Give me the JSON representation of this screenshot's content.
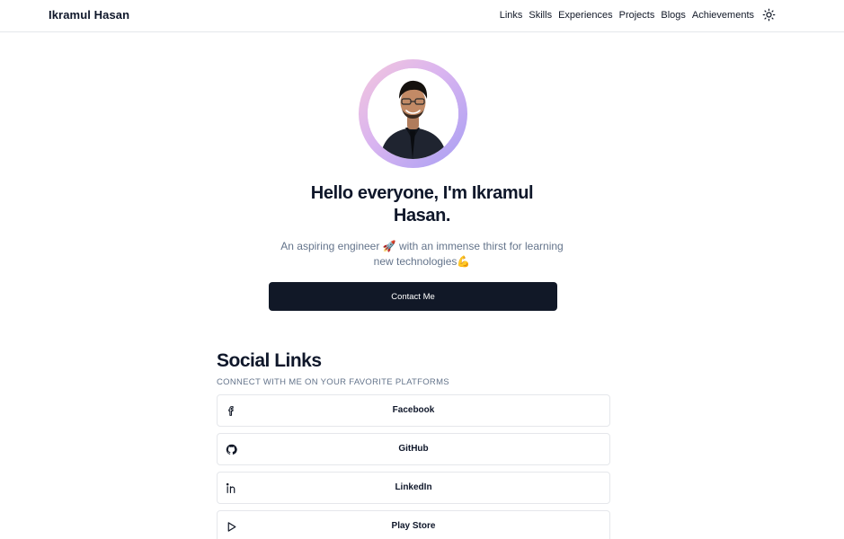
{
  "header": {
    "brand": "Ikramul Hasan",
    "nav": [
      {
        "label": "Links"
      },
      {
        "label": "Skills"
      },
      {
        "label": "Experiences"
      },
      {
        "label": "Projects"
      },
      {
        "label": "Blogs"
      },
      {
        "label": "Achievements"
      }
    ],
    "theme_toggle_icon": "sun-icon"
  },
  "hero": {
    "avatar_icon": "profile-photo",
    "title_line1": "Hello everyone, I'm Ikramul",
    "title_line2": "Hasan.",
    "subtitle_line1": "An aspiring engineer 🚀 with an immense thirst for learning",
    "subtitle_line2": "new technologies💪",
    "contact_label": "Contact Me"
  },
  "social": {
    "title": "Social Links",
    "subtitle": "CONNECT WITH ME ON YOUR FAVORITE PLATFORMS",
    "items": [
      {
        "label": "Facebook",
        "icon": "facebook-icon"
      },
      {
        "label": "GitHub",
        "icon": "github-icon"
      },
      {
        "label": "LinkedIn",
        "icon": "linkedin-icon"
      },
      {
        "label": "Play Store",
        "icon": "play-store-icon"
      }
    ]
  },
  "colors": {
    "text": "#0f172a",
    "muted": "#64748b",
    "button_bg": "#111827",
    "border": "#e5e7eb",
    "ring_start": "#f4c6dc",
    "ring_end": "#a79ff3"
  }
}
